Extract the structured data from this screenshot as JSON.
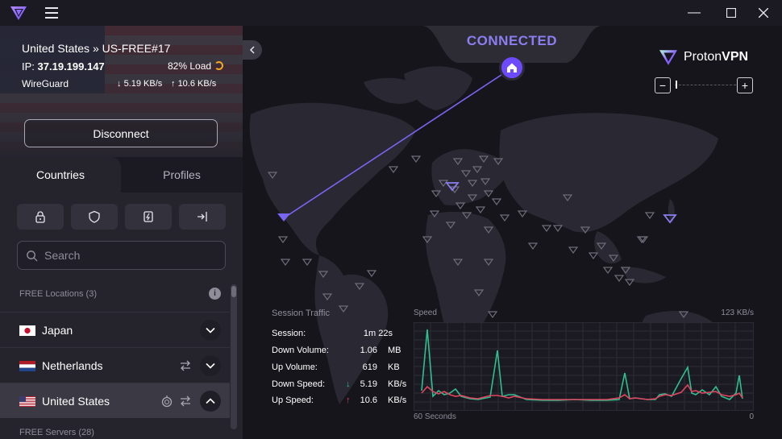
{
  "titlebar": {
    "minimize_icon": "minimize-icon",
    "maximize_icon": "maximize-icon",
    "close_icon": "close-icon"
  },
  "connection": {
    "server": "United States » US-FREE#17",
    "ip_label": "IP:",
    "ip": "37.19.199.147",
    "load": "82% Load",
    "load_percent": 82,
    "protocol": "WireGuard",
    "download": "5.19 KB/s",
    "upload": "10.6 KB/s",
    "disconnect_label": "Disconnect"
  },
  "tabs": [
    "Countries",
    "Profiles"
  ],
  "filters": [
    "lock-icon",
    "shield-icon",
    "torrent-icon",
    "split-tunnel-icon"
  ],
  "search": {
    "placeholder": "Search"
  },
  "free_section": {
    "label": "FREE Locations (3)"
  },
  "countries": [
    {
      "name": "Japan",
      "flag": "flag-jp",
      "selected": false
    },
    {
      "name": "Netherlands",
      "flag": "flag-nl",
      "selected": false
    },
    {
      "name": "United States",
      "flag": "flag-us",
      "selected": true
    }
  ],
  "servers_section": {
    "label": "FREE Servers (28)"
  },
  "map": {
    "status": "CONNECTED",
    "brand_proton": "Proton",
    "brand_vpn": "VPN",
    "zoom_out": "−",
    "zoom_in": "+"
  },
  "session_traffic": {
    "title": "Session Traffic",
    "rows": [
      {
        "label": "Session:",
        "value": "1m 22s",
        "unit": ""
      },
      {
        "label": "Down Volume:",
        "value": "1.06",
        "unit": "MB"
      },
      {
        "label": "Up Volume:",
        "value": "619",
        "unit": "KB"
      },
      {
        "label": "Down Speed:",
        "value": "5.19",
        "unit": "KB/s"
      },
      {
        "label": "Up Speed:",
        "value": "10.6",
        "unit": "KB/s"
      }
    ]
  },
  "speed_chart": {
    "label": "Speed",
    "max_label": "123  KB/s",
    "x_left": "60 Seconds",
    "x_right": "0",
    "colors": {
      "down": "#2fbf8f",
      "up": "#e0445f"
    }
  }
}
